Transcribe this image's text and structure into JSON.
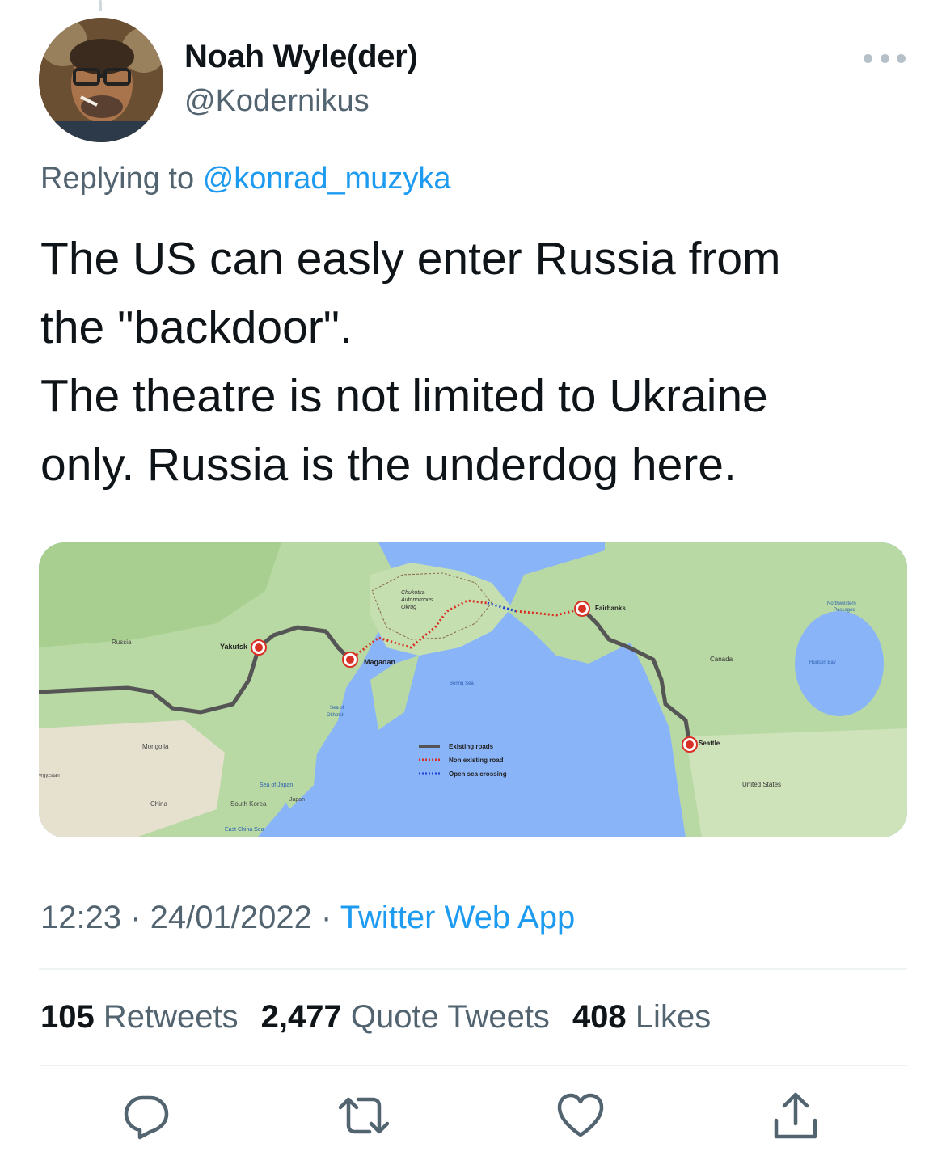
{
  "author": {
    "name": "Noah Wyle(der)",
    "handle": "@Kodernikus"
  },
  "reply": {
    "prefix": "Replying to",
    "mention": "@konrad_muzyka"
  },
  "tweet": {
    "text": "The US can easly enter Russia from\nthe \"backdoor\".\nThe theatre is not limited to Ukraine\nonly. Russia is the underdog here."
  },
  "map": {
    "places": {
      "russia": "Russia",
      "yakutsk": "Yakutsk",
      "magadan": "Magadan",
      "chukotka1": "Chukotka",
      "chukotka2": "Autonomous",
      "chukotka3": "Okrug",
      "fairbanks": "Fairbanks",
      "canada": "Canada",
      "seattle": "Seattle",
      "united_states": "United States",
      "mongolia": "Mongolia",
      "china": "China",
      "south_korea": "South Korea",
      "japan": "Japan",
      "sea_of_japan": "Sea of Japan",
      "east_china_sea": "East China Sea",
      "sea_of_okhotsk1": "Sea of",
      "sea_of_okhotsk2": "Okhotsk",
      "bering_sea": "Bering Sea",
      "hudson_bay": "Hudson Bay",
      "northwestern1": "Northwestern",
      "northwestern2": "Passages",
      "kyrgyzstan": "yrgyzstan"
    },
    "legend": [
      {
        "label": "Existing roads",
        "color": "#555555",
        "style": "solid"
      },
      {
        "label": "Non existing road",
        "color": "#d93025",
        "style": "dotted"
      },
      {
        "label": "Open sea crossing",
        "color": "#1a3fd6",
        "style": "dotted"
      }
    ]
  },
  "meta": {
    "time": "12:23",
    "sep1": " · ",
    "date": "24/01/2022",
    "sep2": " · ",
    "app": "Twitter Web App"
  },
  "stats": {
    "retweets_count": "105",
    "retweets_label": "Retweets",
    "quotes_count": "2,477",
    "quotes_label": "Quote Tweets",
    "likes_count": "408",
    "likes_label": "Likes"
  },
  "icons": [
    "reply-icon",
    "retweet-icon",
    "like-icon",
    "share-icon",
    "more-icon"
  ]
}
